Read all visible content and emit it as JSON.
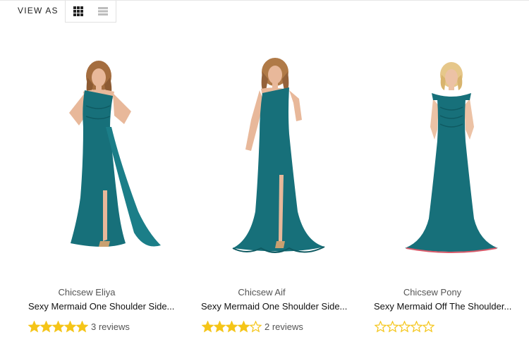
{
  "toolbar": {
    "view_as_label": "VIEW AS",
    "grid_icon": "grid-view-icon",
    "list_icon": "list-view-icon"
  },
  "colors": {
    "accent_star": "#f5c518",
    "dress": "#17707a",
    "dress_dark": "#0f5a62",
    "skin": "#e8b89a",
    "hair_brown": "#a46d3f",
    "hair_blonde": "#e6c78a"
  },
  "products": [
    {
      "brand": "Chicsew Eliya",
      "title": "Sexy Mermaid One Shoulder Side...",
      "rating": 5,
      "reviews": "3 reviews"
    },
    {
      "brand": "Chicsew Aif",
      "title": "Sexy Mermaid One Shoulder Side...",
      "rating": 4,
      "reviews": "2 reviews"
    },
    {
      "brand": "Chicsew Pony",
      "title": "Sexy Mermaid Off The Shoulder...",
      "rating": 0,
      "reviews": ""
    }
  ]
}
